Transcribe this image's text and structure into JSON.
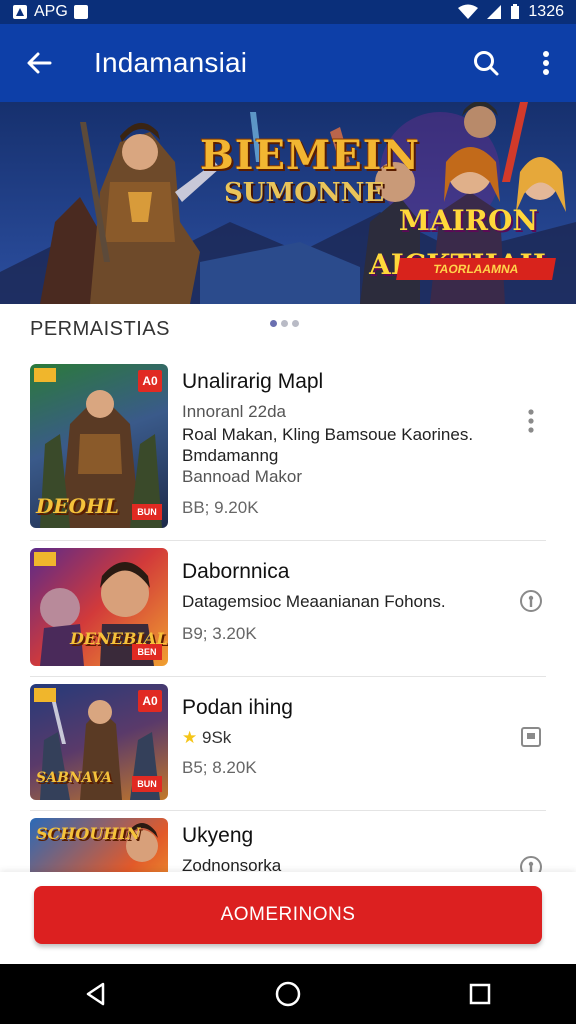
{
  "status_bar": {
    "carrier": "APG",
    "time": "1326"
  },
  "app_bar": {
    "back_icon": "arrow-left-icon",
    "title": "Indamansiai",
    "search_icon": "search-icon",
    "menu_icon": "more-vertical-icon"
  },
  "banner": {
    "title_left": "BIEMEIN",
    "subtitle_left": "SUMONNE",
    "title_right_1": "MAIRON",
    "title_right_2": "AICKTHAH",
    "ribbon": "TAORLAAMNA",
    "page_indicator": {
      "count": 3,
      "active": 0
    }
  },
  "section": {
    "title": "PERMAISTIAS"
  },
  "items": [
    {
      "name": "Unalirarig Mapl",
      "lines": [
        "Innoranl 22da",
        "Roal Makan, Kling Bamsoue Kaorines.",
        "Bmdamanng",
        "Bannoad Makor"
      ],
      "meta": "BB; 9.20K",
      "badge": "A0",
      "thumb_word": "DEOHL",
      "thumb_tag": "BUN",
      "trail_icon": "more-vertical-icon"
    },
    {
      "name": "Dabornnica",
      "lines": [
        "Datagemsioc Meaanianan Fohons."
      ],
      "meta": "B9; 3.20K",
      "badge": "",
      "thumb_word": "DENEBIAL",
      "thumb_tag": "BEN",
      "trail_icon": "info-circle-icon"
    },
    {
      "name": "Podan ihing",
      "lines": [],
      "rating": "9Sk",
      "meta": "B5; 8.20K",
      "badge": "A0",
      "thumb_word": "SABNAVA",
      "thumb_tag": "BUN",
      "trail_icon": "square-outline-icon"
    },
    {
      "name": "Ukyeng",
      "lines": [
        "Zodnonsorka"
      ],
      "meta": "",
      "badge": "",
      "thumb_word": "SCHOUHIN",
      "thumb_tag": "",
      "trail_icon": "info-circle-icon"
    }
  ],
  "cta": {
    "label": "AOMERINONS"
  },
  "nav": {
    "back_icon": "nav-back-icon",
    "home_icon": "nav-home-icon",
    "recents_icon": "nav-recents-icon"
  },
  "colors": {
    "app_bar": "#0d3fa8",
    "status_bar": "#0a2f7a",
    "cta": "#dc2020",
    "star": "#f5c518"
  }
}
